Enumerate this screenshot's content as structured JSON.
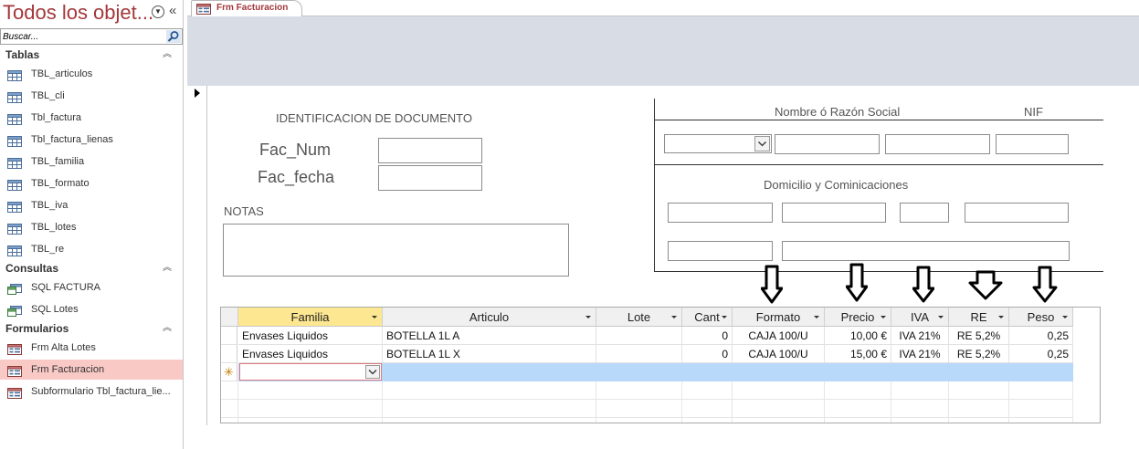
{
  "nav": {
    "title": "Todos los objet...",
    "search_placeholder": "Buscar...",
    "groups": [
      {
        "label": "Tablas",
        "items": [
          "TBL_articulos",
          "TBL_cli",
          "Tbl_factura",
          "Tbl_factura_lienas",
          "TBL_familia",
          "TBL_formato",
          "TBL_iva",
          "TBL_lotes",
          "TBL_re"
        ]
      },
      {
        "label": "Consultas",
        "items": [
          "SQL FACTURA",
          "SQL Lotes"
        ]
      },
      {
        "label": "Formularios",
        "items": [
          "Frm Alta Lotes",
          "Frm Facturacion",
          "Subformulario Tbl_factura_lie..."
        ]
      }
    ],
    "selected_item": "Frm Facturacion"
  },
  "doc_tab": {
    "label": "Frm Facturacion"
  },
  "form": {
    "ident_title": "IDENTIFICACION DE DOCUMENTO",
    "fac_num_label": "Fac_Num",
    "fac_fecha_label": "Fac_fecha",
    "fac_num_value": "",
    "fac_fecha_value": "",
    "notas_label": "NOTAS",
    "notas_value": "",
    "nombre_label": "Nombre ó Razón Social",
    "nif_label": "NIF",
    "domicilio_label": "Domicilio y Cominicaciones"
  },
  "subform": {
    "columns": [
      "Familia",
      "Articulo",
      "Lote",
      "Cant",
      "Formato",
      "Precio",
      "IVA",
      "RE",
      "Peso"
    ],
    "active_column": "Familia",
    "rows": [
      [
        "Envases Liquidos",
        "BOTELLA 1L A",
        "",
        "0",
        "CAJA 100/U",
        "10,00 €",
        "IVA 21%",
        "RE 5,2%",
        "0,25"
      ],
      [
        "Envases Liquidos",
        "BOTELLA 1L X",
        "",
        "0",
        "CAJA 100/U",
        "15,00 €",
        "IVA 21%",
        "RE 5,2%",
        "0,25"
      ]
    ],
    "new_row_marker": "✳"
  },
  "colors": {
    "nav_title": "#a4373a",
    "selected_item_bg": "#f9c9c6",
    "header_band": "#d8dce5",
    "active_header": "#fde791",
    "new_row": "#b9d9fb"
  }
}
